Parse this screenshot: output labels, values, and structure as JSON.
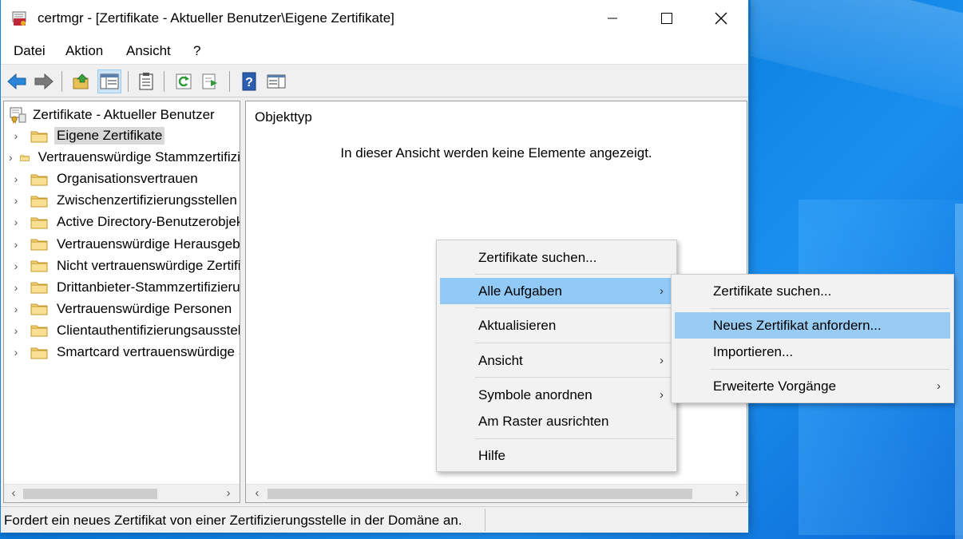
{
  "window": {
    "title": "certmgr - [Zertifikate - Aktueller Benutzer\\Eigene Zertifikate]",
    "minimize_glyph": "—",
    "maximize_glyph": "☐",
    "close_glyph": "✕"
  },
  "menubar": {
    "items": [
      "Datei",
      "Aktion",
      "Ansicht",
      "?"
    ]
  },
  "toolbar": {
    "buttons": [
      "back-arrow-icon",
      "forward-arrow-icon",
      "up-folder-icon",
      "show-hide-tree-icon",
      "properties-icon",
      "refresh-icon",
      "export-list-icon",
      "help-icon",
      "action-pane-icon"
    ]
  },
  "tree": {
    "root_label": "Zertifikate - Aktueller Benutzer",
    "items": [
      {
        "label": "Eigene Zertifikate",
        "selected": true
      },
      {
        "label": "Vertrauenswürdige Stammzertifizierungsstellen"
      },
      {
        "label": "Organisationsvertrauen"
      },
      {
        "label": "Zwischenzertifizierungsstellen"
      },
      {
        "label": "Active Directory-Benutzerobjekt"
      },
      {
        "label": "Vertrauenswürdige Herausgeber"
      },
      {
        "label": "Nicht vertrauenswürdige Zertifikate"
      },
      {
        "label": "Drittanbieter-Stammzertifizierungsstellen"
      },
      {
        "label": "Vertrauenswürdige Personen"
      },
      {
        "label": "Clientauthentifizierungsaussteller"
      },
      {
        "label": "Smartcard vertrauenswürdige Stämme"
      }
    ],
    "chevron": "›"
  },
  "content": {
    "column_header": "Objekttyp",
    "empty_message": "In dieser Ansicht werden keine Elemente angezeigt."
  },
  "scroll": {
    "left_arrow": "‹",
    "right_arrow": "›"
  },
  "context_menu": {
    "items": [
      {
        "label": "Zertifikate suchen...",
        "submenu": false
      },
      {
        "label": "Alle Aufgaben",
        "submenu": true,
        "highlighted": true
      },
      {
        "label": "Aktualisieren",
        "submenu": false
      },
      {
        "label": "Ansicht",
        "submenu": true
      },
      {
        "label": "Symbole anordnen",
        "submenu": true
      },
      {
        "label": "Am Raster ausrichten",
        "submenu": false
      },
      {
        "label": "Hilfe",
        "submenu": false
      }
    ],
    "arrow": "›"
  },
  "submenu": {
    "items": [
      {
        "label": "Zertifikate suchen...",
        "submenu": false
      },
      {
        "label": "Neues Zertifikat anfordern...",
        "submenu": false,
        "highlighted": true
      },
      {
        "label": "Importieren...",
        "submenu": false
      },
      {
        "label": "Erweiterte Vorgänge",
        "submenu": true
      }
    ],
    "arrow": "›"
  },
  "statusbar": {
    "text": "Fordert ein neues Zertifikat von einer Zertifizierungsstelle in der Domäne an."
  },
  "colors": {
    "highlight": "#91c9f7",
    "desktop": "#0a7fe0",
    "window_border": "#1883d7"
  }
}
